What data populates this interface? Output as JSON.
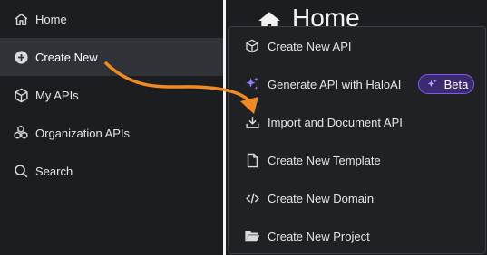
{
  "sidebar": {
    "items": [
      {
        "label": "Home",
        "icon": "home-icon"
      },
      {
        "label": "Create New",
        "icon": "plus-circle-icon",
        "active": true
      },
      {
        "label": "My APIs",
        "icon": "cube-icon"
      },
      {
        "label": "Organization APIs",
        "icon": "cubes-icon"
      },
      {
        "label": "Search",
        "icon": "search-icon"
      }
    ]
  },
  "page": {
    "title": "Home"
  },
  "menu": {
    "items": [
      {
        "label": "Create New API",
        "icon": "cube-icon"
      },
      {
        "label": "Generate API with HaloAI",
        "icon": "sparkles-icon",
        "badge": "Beta"
      },
      {
        "label": "Import and Document API",
        "icon": "import-icon"
      },
      {
        "label": "Create New Template",
        "icon": "file-icon"
      },
      {
        "label": "Create New Domain",
        "icon": "code-icon"
      },
      {
        "label": "Create New Project",
        "icon": "folder-open-icon"
      }
    ]
  },
  "colors": {
    "accent": "#f08a24",
    "beta_border": "#7b5cf0",
    "beta_bg": "#3b2a6e",
    "sparkle": "#8f7cff"
  }
}
